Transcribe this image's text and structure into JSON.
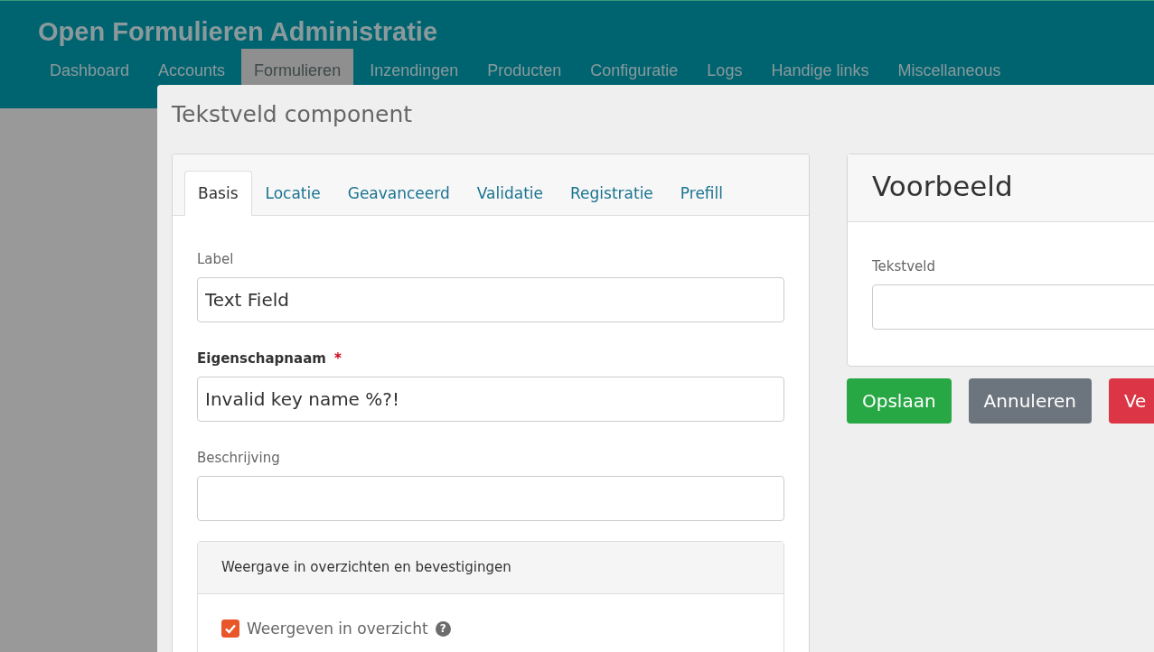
{
  "header": {
    "title": "Open Formulieren Administratie",
    "nav": [
      {
        "label": "Dashboard",
        "selected": false
      },
      {
        "label": "Accounts",
        "selected": false
      },
      {
        "label": "Formulieren",
        "selected": true
      },
      {
        "label": "Inzendingen",
        "selected": false
      },
      {
        "label": "Producten",
        "selected": false
      },
      {
        "label": "Configuratie",
        "selected": false
      },
      {
        "label": "Logs",
        "selected": false
      },
      {
        "label": "Handige links",
        "selected": false
      },
      {
        "label": "Miscellaneous",
        "selected": false
      }
    ]
  },
  "modal": {
    "title": "Tekstveld component",
    "tabs": [
      {
        "label": "Basis",
        "selected": true
      },
      {
        "label": "Locatie",
        "selected": false
      },
      {
        "label": "Geavanceerd",
        "selected": false
      },
      {
        "label": "Validatie",
        "selected": false
      },
      {
        "label": "Registratie",
        "selected": false
      },
      {
        "label": "Prefill",
        "selected": false
      }
    ],
    "fields": [
      {
        "label": "Label",
        "required": false,
        "value": "Text Field"
      },
      {
        "label": "Eigenschapnaam",
        "required": true,
        "required_mark": "*",
        "value": "Invalid key name %?!"
      },
      {
        "label": "Beschrijving",
        "required": false
      }
    ],
    "section": {
      "title": "Weergave in overzichten en bevestigingen",
      "checkbox": {
        "label": "Weergeven in overzicht",
        "checked": true,
        "help": "?"
      }
    },
    "preview": {
      "title": "Voorbeeld",
      "field_label": "Tekstveld"
    },
    "buttons": [
      {
        "label": "Opslaan",
        "kind": "success"
      },
      {
        "label": "Annuleren",
        "kind": "secondary"
      },
      {
        "label": "Ve",
        "kind": "danger"
      }
    ]
  }
}
